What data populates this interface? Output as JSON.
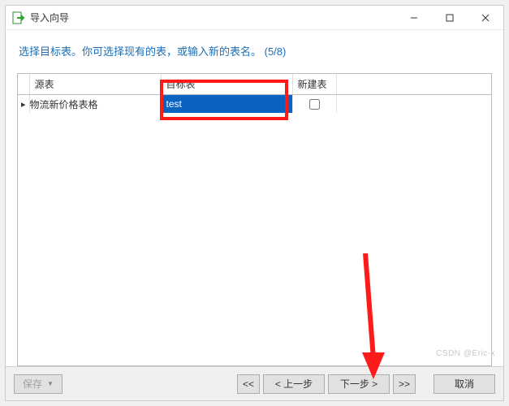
{
  "titlebar": {
    "title": "导入向导"
  },
  "instruction": "选择目标表。你可选择现有的表，或输入新的表名。 (5/8)",
  "table": {
    "headers": {
      "source": "源表",
      "target": "目标表",
      "newtable": "新建表"
    },
    "rows": [
      {
        "source": "物流新价格表格",
        "target": "test",
        "newtable": false
      }
    ]
  },
  "footer": {
    "save": "保存",
    "first": "<<",
    "prev": "< 上一步",
    "next": "下一步 >",
    "last": ">>",
    "cancel": "取消"
  },
  "watermark": "CSDN @Eric-x"
}
